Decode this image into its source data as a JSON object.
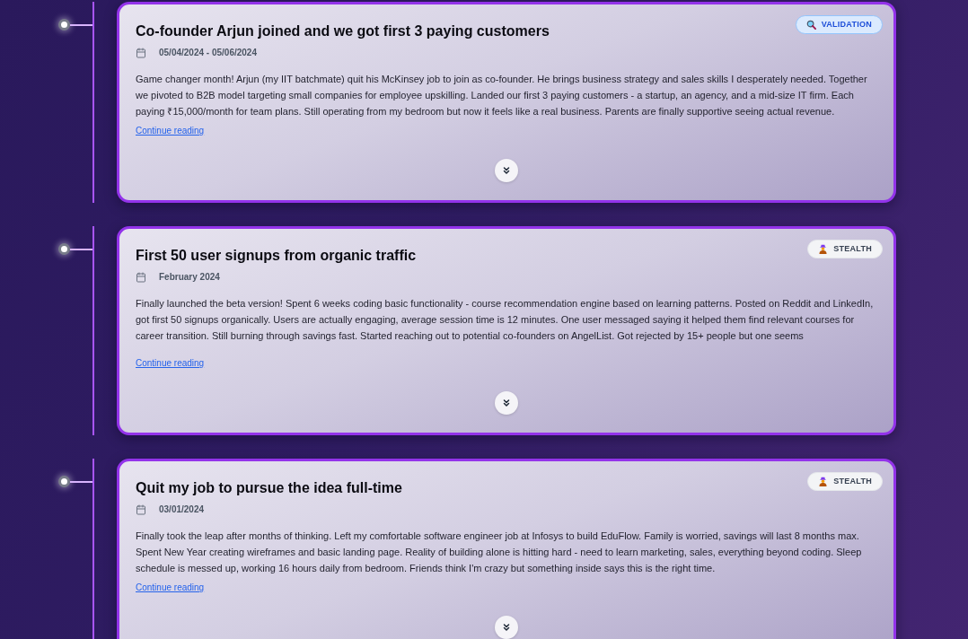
{
  "entries": [
    {
      "title": "Co-founder Arjun joined and we got first 3 paying customers",
      "date": "05/04/2024 - 05/06/2024",
      "badge": {
        "kind": "validation",
        "label": "VALIDATION"
      },
      "description": "Game changer month! Arjun (my IIT batchmate) quit his McKinsey job to join as co-founder. He brings business strategy and sales skills I desperately needed. Together we pivoted to B2B model targeting small companies for employee upskilling. Landed our first 3 paying customers - a startup, an agency, and a mid-size IT firm. Each paying ₹15,000/month for team plans. Still operating from my bedroom but now it feels like a real business. Parents are finally supportive seeing actual revenue.",
      "truncated": false,
      "link": "Continue reading",
      "expanded": false
    },
    {
      "title": "First 50 user signups from organic traffic",
      "date": "February 2024",
      "badge": {
        "kind": "stealth",
        "label": "STEALTH"
      },
      "description": "Finally launched the beta version! Spent 6 weeks coding basic functionality - course recommendation engine based on learning patterns. Posted on Reddit and LinkedIn, got first 50 signups organically. Users are actually engaging, average session time is 12 minutes. One user messaged saying it helped them find relevant courses for career transition. Still burning through savings fast. Started reaching out to potential co-founders on AngelList. Got rejected by 15+ people but one seems",
      "truncated": true,
      "link": "Continue reading",
      "expanded": false
    },
    {
      "title": "Quit my job to pursue the idea full-time",
      "date": "03/01/2024",
      "badge": {
        "kind": "stealth",
        "label": "STEALTH"
      },
      "description": "Finally took the leap after months of thinking. Left my comfortable software engineer job at Infosys to build EduFlow. Family is worried, savings will last 8 months max. Spent New Year creating wireframes and basic landing page. Reality of building alone is hitting hard - need to learn marketing, sales, everything beyond coding. Sleep schedule is messed up, working 16 hours daily from bedroom. Friends think I'm crazy but something inside says this is the right time.",
      "truncated": false,
      "link": "Continue reading",
      "expanded": false
    }
  ]
}
